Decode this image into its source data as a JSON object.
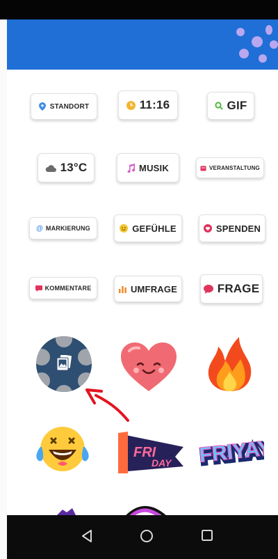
{
  "stickers": {
    "row1": [
      {
        "label": "STANDORT",
        "icon": "location-pin-icon",
        "color": "#3f8ee6"
      },
      {
        "label": "11:16",
        "icon": "clock-icon",
        "color": "#f2b531"
      },
      {
        "label": "GIF",
        "icon": "search-icon",
        "color": "#53b544"
      }
    ],
    "row2": [
      {
        "label": "13°C",
        "icon": "cloud-icon",
        "color": "#6b6b6b"
      },
      {
        "label": "MUSIK",
        "icon": "music-note-icon",
        "color": "#d75fc6"
      },
      {
        "label": "VERANSTALTUNG",
        "icon": "calendar-icon",
        "color": "#e0345c"
      }
    ],
    "row3": [
      {
        "label": "MARKIERUNG",
        "icon": "at-sign-icon",
        "color": "#3f8ee6"
      },
      {
        "label": "GEFÜHLE",
        "icon": "emoji-slider-icon",
        "color": "#f2c531"
      },
      {
        "label": "SPENDEN",
        "icon": "donation-icon",
        "color": "#e0345c"
      }
    ],
    "row4": [
      {
        "label": "KOMMENTARE",
        "icon": "comment-bubble-icon",
        "color": "#e0345c"
      },
      {
        "label": "UMFRAGE",
        "icon": "bar-chart-icon",
        "color": "#f08a24"
      },
      {
        "label": "FRAGE",
        "icon": "speech-bubble-icon",
        "color": "#e0345c"
      }
    ]
  },
  "emoji_stickers": [
    "gallery-photo-icon",
    "smiling-heart-icon",
    "fire-icon",
    "laughing-tears-icon",
    "friday-banner-icon",
    "friyay-text-icon"
  ],
  "sticker_text": {
    "friday_top": "FRI",
    "friday_bottom": "DAY",
    "friyay": "FRIYAY!"
  },
  "nav": [
    "back-icon",
    "home-icon",
    "recents-icon"
  ],
  "colors": {
    "header_blue": "#1f6fd6",
    "arrow_red": "#e3141f"
  }
}
